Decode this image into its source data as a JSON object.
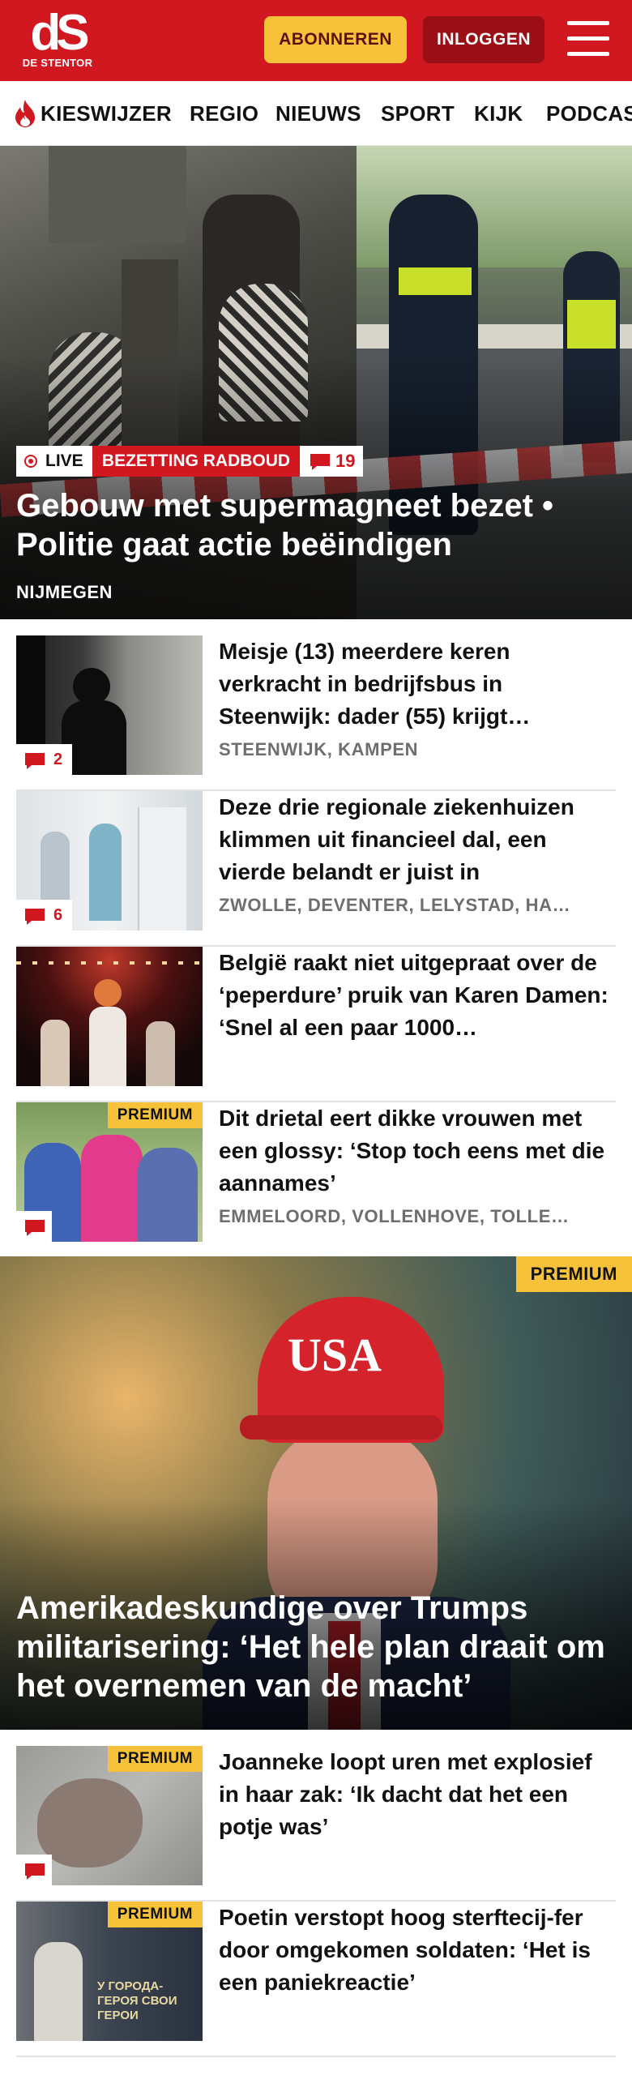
{
  "header": {
    "logo_mark": "dS",
    "logo_sub": "DE STENTOR",
    "subscribe_label": "ABONNEREN",
    "login_label": "INLOGGEN",
    "menu_icon": "hamburger-icon",
    "colors": {
      "brand_red": "#d1171f",
      "subscribe_yellow": "#f6c23a",
      "login_dark_red": "#9a0e15"
    }
  },
  "nav": {
    "items": [
      {
        "label": "KIESWIJZER",
        "icon": "flame-icon"
      },
      {
        "label": "REGIO"
      },
      {
        "label": "NIEUWS"
      },
      {
        "label": "SPORT"
      },
      {
        "label": "KIJK"
      },
      {
        "label": "PODCAS"
      }
    ]
  },
  "hero": {
    "live_label": "LIVE",
    "topic_label": "BEZETTING RADBOUD",
    "comment_count": "19",
    "title": "Gebouw met supermagneet bezet • Politie gaat actie beëindigen",
    "location": "NIJMEGEN"
  },
  "articles": [
    {
      "title": "Meisje (13) meerdere keren verkracht in bedrijfsbus in Steenwijk: dader (55) krijgt…",
      "location": "STEENWIJK, KAMPEN",
      "comments": "2",
      "premium": ""
    },
    {
      "title": "Deze drie regionale ziekenhuizen klimmen uit financieel dal, een vierde belandt er juist in",
      "location": "ZWOLLE, DEVENTER, LELYSTAD, HA…",
      "comments": "6",
      "premium": ""
    },
    {
      "title": "België raakt niet uitgepraat over de ‘peperdure’ pruik van Karen Damen: ‘Snel al een paar 1000…",
      "location": "",
      "comments": "",
      "premium": ""
    },
    {
      "title": "Dit drietal eert dikke vrouwen met een glossy: ‘Stop toch eens met die aannames’",
      "location": "EMMELOORD, VOLLENHOVE, TOLLE…",
      "comments": "",
      "premium": "PREMIUM"
    }
  ],
  "feature": {
    "premium": "PREMIUM",
    "cap_text": "USA",
    "title": "Amerikadeskundige over Trumps militarisering: ‘Het hele plan draait om het overnemen van de macht’"
  },
  "articles_bottom": [
    {
      "title": "Joanneke loopt uren met explosief in haar zak: ‘Ik dacht dat het een potje was’",
      "premium": "PREMIUM"
    },
    {
      "title": "Poetin verstopt hoog sterftecij-fer door omgekomen soldaten: ‘Het is een paniekreactie’",
      "premium": "PREMIUM",
      "image_text": "У ГОРОДА-ГЕРОЯ СВОИ ГЕРОИ"
    }
  ]
}
